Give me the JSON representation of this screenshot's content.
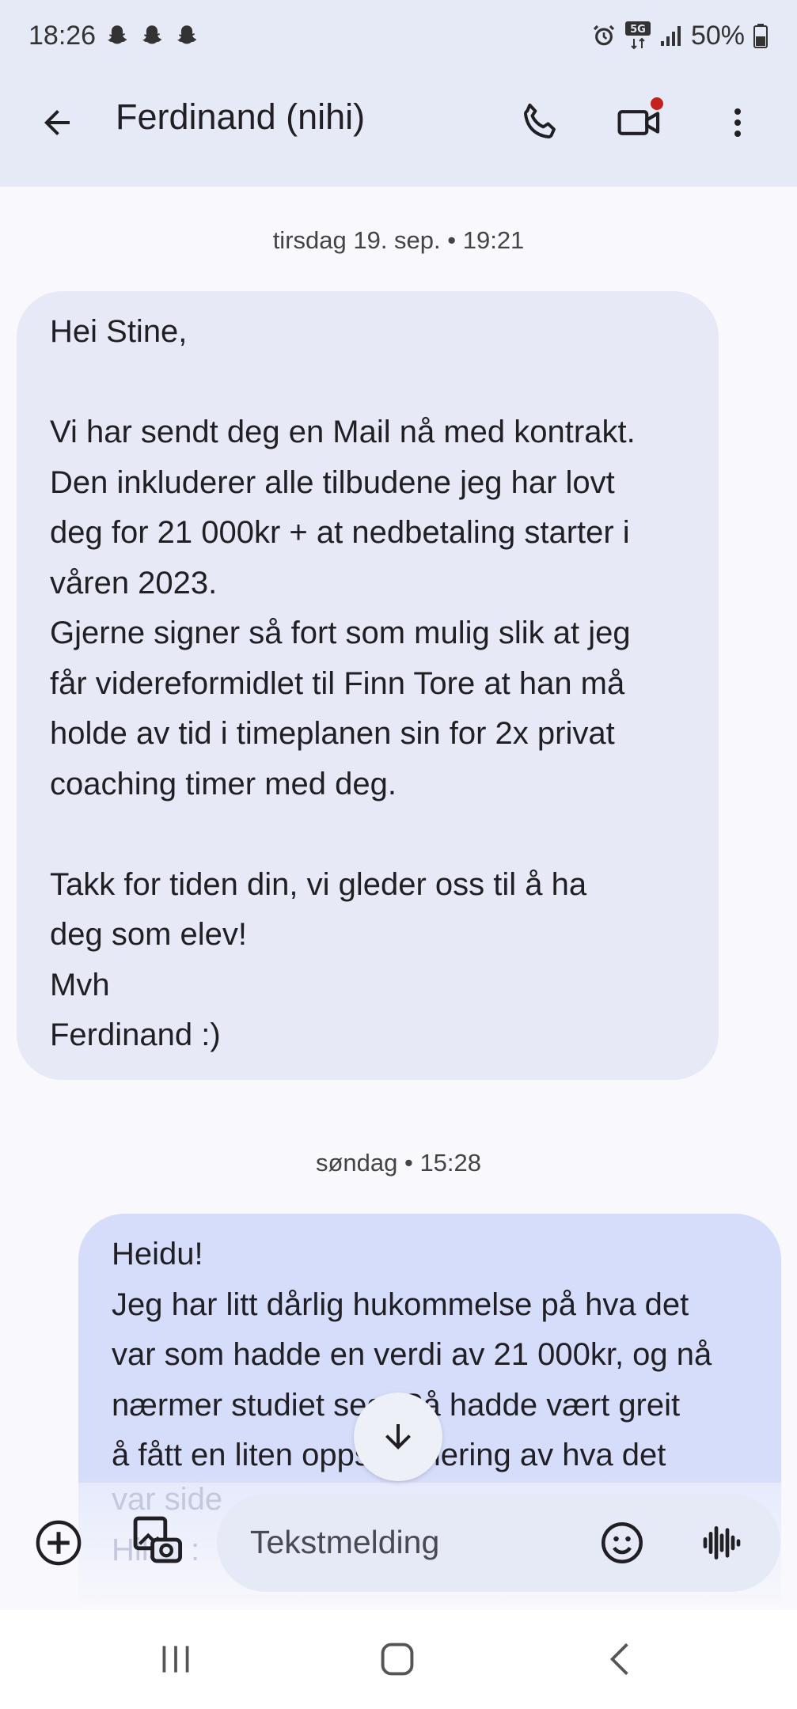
{
  "status_bar": {
    "time": "18:26",
    "battery": "50%",
    "network": "5G",
    "left_icons": [
      "snapchat-icon",
      "snapchat-icon",
      "snapchat-icon"
    ],
    "right_icons": [
      "alarm-icon",
      "5g-icon",
      "signal-icon",
      "battery-icon"
    ]
  },
  "app_bar": {
    "contact_name": "Ferdinand (nihi)",
    "actions": [
      "back-arrow-icon",
      "phone-icon",
      "video-call-icon",
      "more-vert-icon"
    ]
  },
  "messages": [
    {
      "timestamp": "tirsdag 19. sep. • 19:21",
      "direction": "incoming",
      "text": "Hei Stine,\n\nVi har sendt deg en Mail nå med kontrakt.\nDen inkluderer alle tilbudene jeg har lovt\ndeg for 21 000kr + at nedbetaling starter i\nvåren 2023.\nGjerne signer så fort som mulig slik at jeg\nfår videreformidlet til Finn Tore at han må\nholde av tid i timeplanen sin for 2x privat\ncoaching timer med deg.\n\nTakk for tiden din, vi gleder oss til å ha\ndeg som elev!\nMvh\nFerdinand :)"
    },
    {
      "timestamp": "søndag • 15:28",
      "direction": "outgoing",
      "text": "Heidu!\nJeg har litt dårlig hukommelse på hva det\nvar som hadde en verdi av 21 000kr, og nå\nnærmer studiet seg. Så hadde vært greit\nå fått en liten oppsummering av hva det",
      "faded_text": "var side\nHilse :"
    }
  ],
  "composer": {
    "placeholder": "Tekstmelding",
    "icons": [
      "add-circle-icon",
      "gallery-icon",
      "emoji-icon",
      "voice-icon"
    ]
  },
  "nav_bar": {
    "icons": [
      "recents-icon",
      "home-icon",
      "back-icon"
    ]
  },
  "colors": {
    "header_bg": "#e6eaf6",
    "incoming_bubble": "#e7e9f6",
    "outgoing_bubble": "#d6ddfa",
    "notification_dot": "#c5221f"
  }
}
